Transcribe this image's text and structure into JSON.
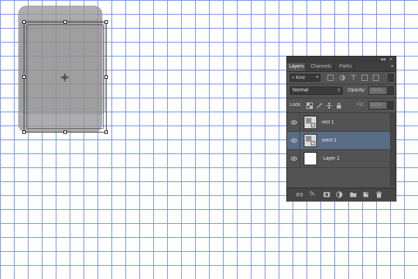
{
  "panel": {
    "topbar": {
      "collapse_glyph": "◂◂",
      "close_glyph": "×"
    },
    "tabs": [
      {
        "label": "Layers",
        "active": true
      },
      {
        "label": "Channels",
        "active": false
      },
      {
        "label": "Paths",
        "active": false
      }
    ],
    "tab_menu_glyph": "≡",
    "filter": {
      "kind_label": "Kind",
      "search_glyph": "⌕"
    },
    "blend_mode": "Normal",
    "opacity_label": "Opacity:",
    "opacity_value": "100%",
    "lock_label": "Lock:",
    "fill_label": "Fill:",
    "fill_value": "100%",
    "layers": [
      {
        "name": "rect 1",
        "selected": false,
        "thumbnail": "shape"
      },
      {
        "name": "srect 1",
        "selected": true,
        "thumbnail": "shape"
      },
      {
        "name": "Layer 1",
        "selected": false,
        "thumbnail": "white"
      }
    ],
    "footer_icons": [
      "link-icon",
      "fx-icon",
      "mask-icon",
      "adjustment-icon",
      "folder-icon",
      "new-layer-icon",
      "trash-icon"
    ],
    "fx_label": "fx."
  },
  "colors": {
    "grid_line": "#6b8fe6",
    "panel_bg": "#535353",
    "selected_row": "#5a6d86",
    "shape_fill": "#969696"
  }
}
